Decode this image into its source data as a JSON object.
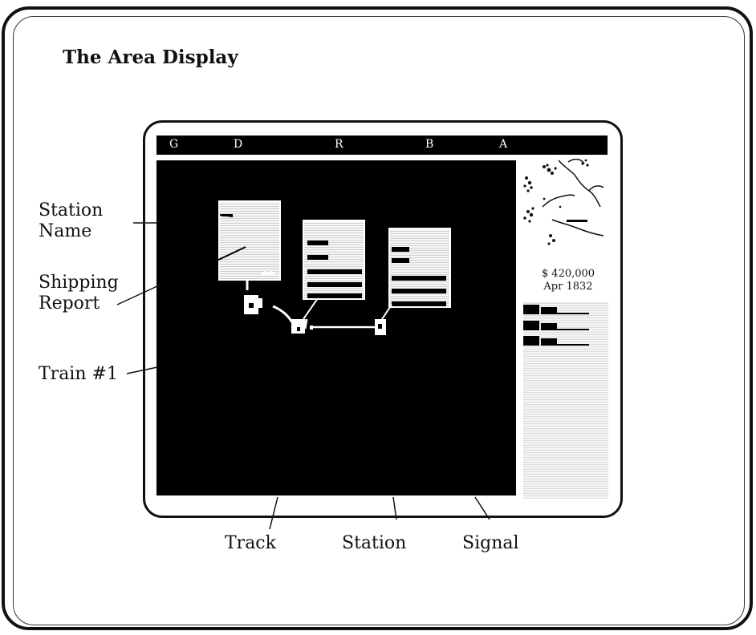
{
  "title": "The Area Display",
  "menu": {
    "items": [
      "G",
      "D",
      "R",
      "B",
      "A"
    ]
  },
  "status": {
    "cash": "$  420,000",
    "date": "Apr 1832"
  },
  "callouts": {
    "station_name": [
      "Station",
      "Name"
    ],
    "shipping_report": [
      "Shipping",
      "Report"
    ],
    "train": "Train #1",
    "track": "Track",
    "station": "Station",
    "signal": "Signal"
  }
}
